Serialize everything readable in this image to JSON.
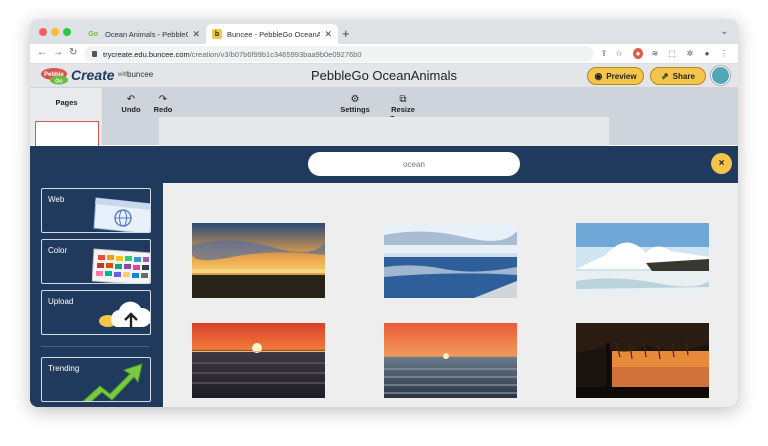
{
  "browser": {
    "tabs": [
      {
        "label": "Ocean Animals - PebbleGo",
        "favicon": "Go",
        "active": false
      },
      {
        "label": "Buncee - PebbleGo OceanAnim",
        "favicon": "b",
        "active": true
      }
    ],
    "new_tab": "+",
    "tab_menu": "⌄",
    "url_host": "trycreate.edu.buncee.com",
    "url_path": "/creation/v3/b07b6f99b1c3465993baa9b0e09276b0"
  },
  "app": {
    "logo": {
      "create": "Create",
      "with": "with",
      "buncee": "buncee"
    },
    "title": "PebbleGo OceanAnimals",
    "preview_label": "Preview",
    "share_label": "Share"
  },
  "editor": {
    "pages_label": "Pages",
    "tools": {
      "undo": "Undo",
      "redo": "Redo",
      "settings": "Settings",
      "resize": "Resize Canvas"
    }
  },
  "media_picker": {
    "search_value": "ocean",
    "close_label": "×",
    "sources": [
      {
        "label": "Web",
        "icon": "web-globe-icon"
      },
      {
        "label": "Color",
        "icon": "color-palette-icon"
      },
      {
        "label": "Upload",
        "icon": "cloud-upload-icon"
      },
      {
        "label": "Trending",
        "icon": "trending-arrow-icon"
      }
    ],
    "results": [
      {
        "icon": "ocean-sunset-clouds-image"
      },
      {
        "icon": "ocean-waves-blue-image"
      },
      {
        "icon": "waves-rocks-splash-image"
      },
      {
        "icon": "ocean-sunset-red-sky-image"
      },
      {
        "icon": "ocean-sunset-orange-image"
      },
      {
        "icon": "beach-hut-sunset-image"
      }
    ]
  },
  "colors": {
    "accent": "#f3c54b",
    "modal_bg": "#1f3a5c",
    "results_bg": "#eeeeee"
  }
}
